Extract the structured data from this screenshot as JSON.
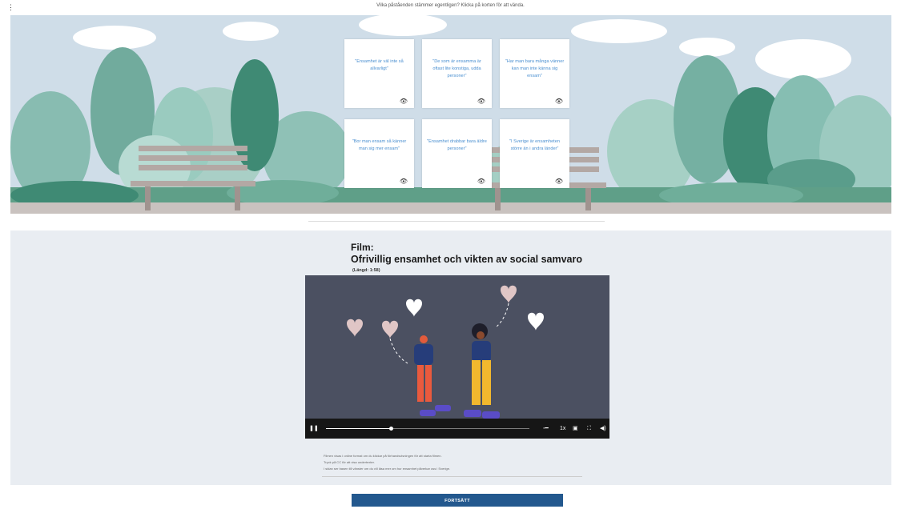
{
  "top": {
    "menu_icon": "vertical-ellipsis-icon",
    "instruction": "Vilka påståenden stämmer egentligen? Klicka på korten för att vända."
  },
  "cards": [
    {
      "text": "\"Ensamhet är väl inte så allvarligt\"",
      "icon": "flip-eye-icon"
    },
    {
      "text": "\"De som är ensamma är oftast lite konstiga, udda personer\"",
      "icon": "flip-eye-icon"
    },
    {
      "text": "\"Har man bara många vänner kan man inte känna sig ensam\"",
      "icon": "flip-eye-icon"
    },
    {
      "text": "\"Bor man ensam så känner man sig mer ensam\"",
      "icon": "flip-eye-icon"
    },
    {
      "text": "\"Ensamhet drabbar bara äldre personer\"",
      "icon": "flip-eye-icon"
    },
    {
      "text": "\"I Sverige är ensamheten större än i andra länder\"",
      "icon": "flip-eye-icon"
    }
  ],
  "film": {
    "label": "Film:",
    "title": "Ofrivillig ensamhet och vikten av social samvaro",
    "length": "(Längd: 1:58)"
  },
  "video": {
    "progress": 0.32,
    "speed_label": "1x",
    "icons": [
      "pause-icon",
      "captions-icon",
      "speed-icon",
      "picture-in-picture-icon",
      "fullscreen-icon",
      "volume-icon"
    ]
  },
  "notes": [
    "Filmen visas i online format om du klickar på förhandsvisningen för att starta filmen.",
    "Tryck på CC för att visa undertexter.",
    "I sidan ser basen till vänster om du vill läsa mer om hur ensamhet påverkar oss i Sverige."
  ],
  "continue_label": "FORTSÄTT",
  "colors": {
    "card_text": "#4a8fd0",
    "button": "#23588e",
    "video_bg": "#4b5061",
    "scene_sky": "#cfdde8",
    "section_bg": "#e9edf2"
  }
}
